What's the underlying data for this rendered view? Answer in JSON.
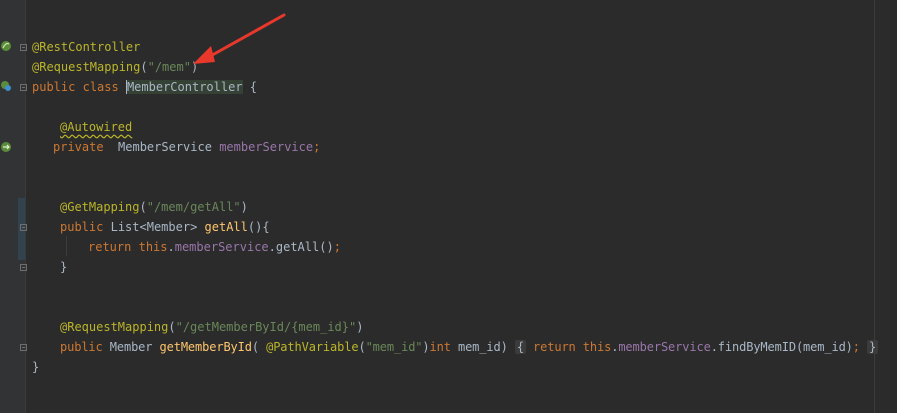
{
  "code": {
    "l1_annotation": "@RestController",
    "l2_annotation": "@RequestMapping",
    "l2_open": "(",
    "l2_string": "\"/mem\"",
    "l2_close": ")",
    "l3_public": "public",
    "l3_class": "class",
    "l3_name": "MemberController",
    "l3_brace": "{",
    "l5_annotation": "@Autowired",
    "l6_private": "private",
    "l6_type": "MemberService",
    "l6_field": "memberService",
    "l6_semi": ";",
    "l9_annotation": "@GetMapping",
    "l9_open": "(",
    "l9_string": "\"/mem/getAll\"",
    "l9_close": ")",
    "l10_public": "public",
    "l10_type": "List<Member>",
    "l10_method": "getAll",
    "l10_rest": "(){",
    "l11_return": "return",
    "l11_this": "this",
    "l11_dot": ".",
    "l11_field": "memberService",
    "l11_call": ".getAll()",
    "l11_semi": ";",
    "l12_brace": "}",
    "l15_annotation": "@RequestMapping",
    "l15_open": "(",
    "l15_string": "\"/getMemberById/{mem_id}\"",
    "l15_close": ")",
    "l16_public": "public",
    "l16_type": "Member",
    "l16_method": "getMemberById",
    "l16_paren": "(",
    "l16_pv": "@PathVariable",
    "l16_pv_open": "(",
    "l16_pv_string": "\"mem_id\"",
    "l16_pv_close": ")",
    "l16_int": "int",
    "l16_param": "mem_id)",
    "l16_lbrace": "{",
    "l16_return": "return",
    "l16_this": "this",
    "l16_dot": ".",
    "l16_field": "memberService",
    "l16_call": ".findByMemID(mem_id)",
    "l16_semi": ";",
    "l16_rbrace": "}",
    "l17_brace": "}"
  },
  "gutter_icons": [
    "spring-bean-icon",
    "spring-mapping-icon",
    "spring-injection-icon"
  ],
  "colors": {
    "background": "#2b2b2b",
    "keyword": "#cc7832",
    "annotation": "#bbb529",
    "string": "#6a8759",
    "field": "#9876aa",
    "method": "#ffc66d",
    "text": "#a9b7c6",
    "arrow": "#e8382c"
  }
}
